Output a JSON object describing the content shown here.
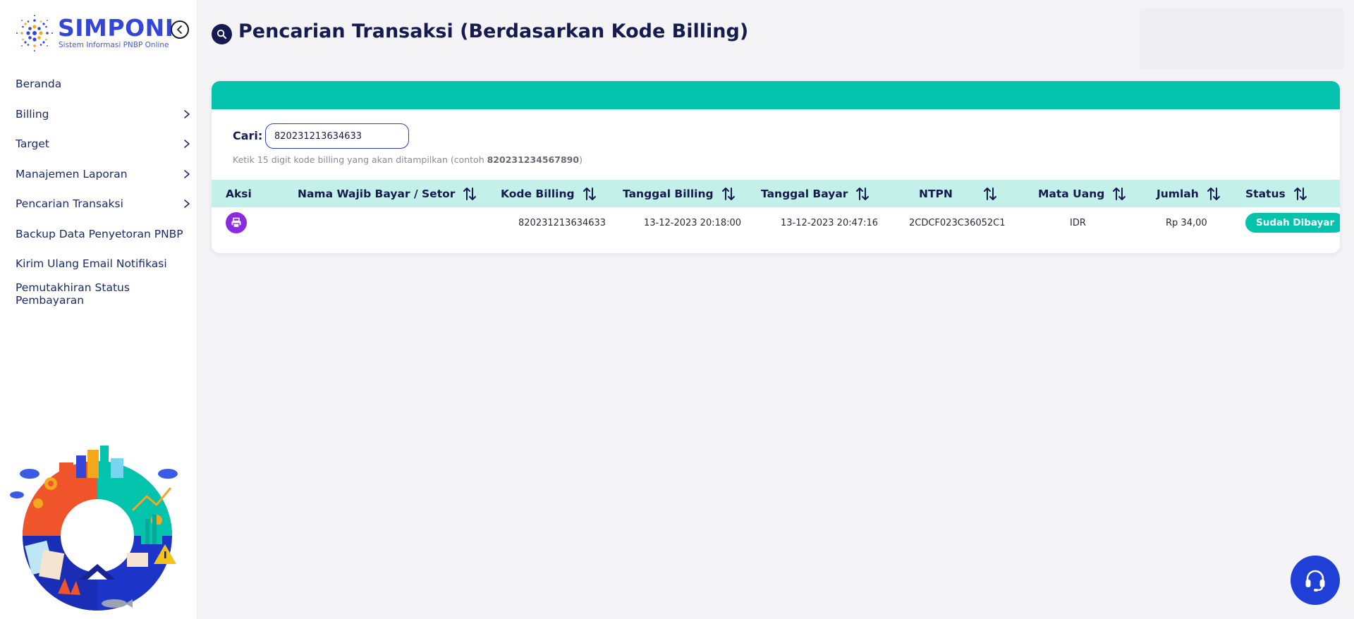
{
  "brand": {
    "name": "SIMPONI",
    "subtitle": "Sistem Informasi PNBP Online"
  },
  "sidebar": {
    "items": [
      {
        "label": "Beranda",
        "has_children": false
      },
      {
        "label": "Billing",
        "has_children": true
      },
      {
        "label": "Target",
        "has_children": true
      },
      {
        "label": "Manajemen Laporan",
        "has_children": true
      },
      {
        "label": "Pencarian Transaksi",
        "has_children": true
      },
      {
        "label": "Backup Data Penyetoran PNBP",
        "has_children": false
      },
      {
        "label": "Kirim Ulang Email Notifikasi",
        "has_children": false
      },
      {
        "label": "Pemutakhiran Status Pembayaran",
        "has_children": false
      }
    ]
  },
  "page": {
    "title": "Pencarian Transaksi (Berdasarkan Kode Billing)"
  },
  "search": {
    "label": "Cari:",
    "value": "820231213634633",
    "hint_prefix": "Ketik 15 digit kode billing yang akan ditampilkan (contoh ",
    "hint_example": "820231234567890",
    "hint_suffix": ")"
  },
  "table": {
    "columns": [
      "Aksi",
      "Nama Wajib Bayar / Setor",
      "Kode Billing",
      "Tanggal Billing",
      "Tanggal Bayar",
      "NTPN",
      "Mata Uang",
      "Jumlah",
      "Status"
    ],
    "rows": [
      {
        "nama": "",
        "kode_billing": "820231213634633",
        "tanggal_billing": "13-12-2023 20:18:00",
        "tanggal_bayar": "13-12-2023 20:47:16",
        "ntpn": "2CDCF023C36052C1",
        "mata_uang": "IDR",
        "jumlah": "Rp 34,00",
        "status": "Sudah Dibayar"
      }
    ]
  },
  "icons": {
    "collapse": "chevron-left-circle-icon",
    "title": "search-icon",
    "sort": "sort-arrows-icon",
    "print": "printer-icon",
    "help": "headset-icon"
  },
  "colors": {
    "brand": "#3346d8",
    "primary_dark": "#151b4e",
    "accent_teal": "#04c3ad",
    "table_header_bg": "#c4f0ea",
    "print_button": "#8a2be2",
    "help_button": "#1f3fd6"
  }
}
